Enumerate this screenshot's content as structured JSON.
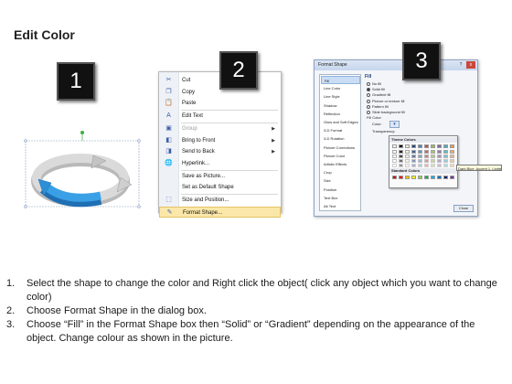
{
  "title": "Edit Color",
  "badges": [
    "1",
    "2",
    "3"
  ],
  "context_menu": {
    "items": [
      {
        "label": "Cut",
        "icon": "scissors-icon",
        "glyph": "✂",
        "disabled": false,
        "submenu": false,
        "active": false
      },
      {
        "label": "Copy",
        "icon": "copy-icon",
        "glyph": "❐",
        "disabled": false,
        "submenu": false,
        "active": false
      },
      {
        "label": "Paste",
        "icon": "paste-icon",
        "glyph": "📋",
        "disabled": false,
        "submenu": false,
        "active": false
      },
      {
        "label": "Edit Text",
        "icon": "edit-text-icon",
        "glyph": "A",
        "disabled": false,
        "submenu": false,
        "active": false
      },
      {
        "label": "Group",
        "icon": "group-icon",
        "glyph": "▣",
        "disabled": true,
        "submenu": true,
        "active": false
      },
      {
        "label": "Bring to Front",
        "icon": "bring-front-icon",
        "glyph": "◧",
        "disabled": false,
        "submenu": true,
        "active": false
      },
      {
        "label": "Send to Back",
        "icon": "send-back-icon",
        "glyph": "◨",
        "disabled": false,
        "submenu": true,
        "active": false
      },
      {
        "label": "Hyperlink...",
        "icon": "hyperlink-icon",
        "glyph": "🌐",
        "disabled": false,
        "submenu": false,
        "active": false
      },
      {
        "label": "Save as Picture...",
        "icon": "",
        "glyph": "",
        "disabled": false,
        "submenu": false,
        "active": false
      },
      {
        "label": "Set as Default Shape",
        "icon": "",
        "glyph": "",
        "disabled": false,
        "submenu": false,
        "active": false
      },
      {
        "label": "Size and Position...",
        "icon": "size-icon",
        "glyph": "⬚",
        "disabled": false,
        "submenu": false,
        "active": false
      },
      {
        "label": "Format Shape...",
        "icon": "format-shape-icon",
        "glyph": "✎",
        "disabled": false,
        "submenu": false,
        "active": true
      }
    ]
  },
  "dialog": {
    "title": "Format Shape",
    "help": "?",
    "close": "x",
    "categories": [
      "Fill",
      "Line Color",
      "Line Style",
      "Shadow",
      "Reflection",
      "Glow and Soft Edges",
      "3-D Format",
      "3-D Rotation",
      "Picture Corrections",
      "Picture Color",
      "Artistic Effects",
      "Crop",
      "Size",
      "Position",
      "Text Box",
      "Alt Text"
    ],
    "selected_category": "Fill",
    "section_heading": "Fill",
    "fill_options": [
      {
        "label": "No fill",
        "selected": false
      },
      {
        "label": "Solid fill",
        "selected": true
      },
      {
        "label": "Gradient fill",
        "selected": false
      },
      {
        "label": "Picture or texture fill",
        "selected": false
      },
      {
        "label": "Pattern fill",
        "selected": false
      },
      {
        "label": "Slide background fill",
        "selected": false
      }
    ],
    "fill_color_label": "Fill Color",
    "color_label": "Color:",
    "transparency_label": "Transparency:",
    "close_button": "Close",
    "palette": {
      "theme_heading": "Theme Colors",
      "standard_heading": "Standard Colors",
      "theme_colors": [
        "#ffffff",
        "#000000",
        "#eeece1",
        "#1f497d",
        "#4f81bd",
        "#c0504d",
        "#9bbb59",
        "#8064a2",
        "#4bacc6",
        "#f79646"
      ],
      "standard_colors": [
        "#c00000",
        "#ff0000",
        "#ffc000",
        "#ffff00",
        "#92d050",
        "#00b050",
        "#00b0f0",
        "#0070c0",
        "#002060",
        "#7030a0"
      ],
      "tooltip": "Dark Blue, Accent 1, Lighter"
    }
  },
  "instructions": [
    {
      "number": "1.",
      "text": "Select the shape to change the color and Right click the object( click any object which you want to change color)"
    },
    {
      "number": "2.",
      "text": "Choose Format Shape in the dialog box."
    },
    {
      "number": "3.",
      "text": "Choose “Fill” in the Format Shape box then “Solid” or “Gradient” depending on the appearance of the object. Change colour as shown in the picture."
    }
  ],
  "colors": {
    "arrow_blue": "#2e8fd6",
    "arrow_grey": "#c8c8c8",
    "menu_highlight": "#fbe7a8"
  }
}
